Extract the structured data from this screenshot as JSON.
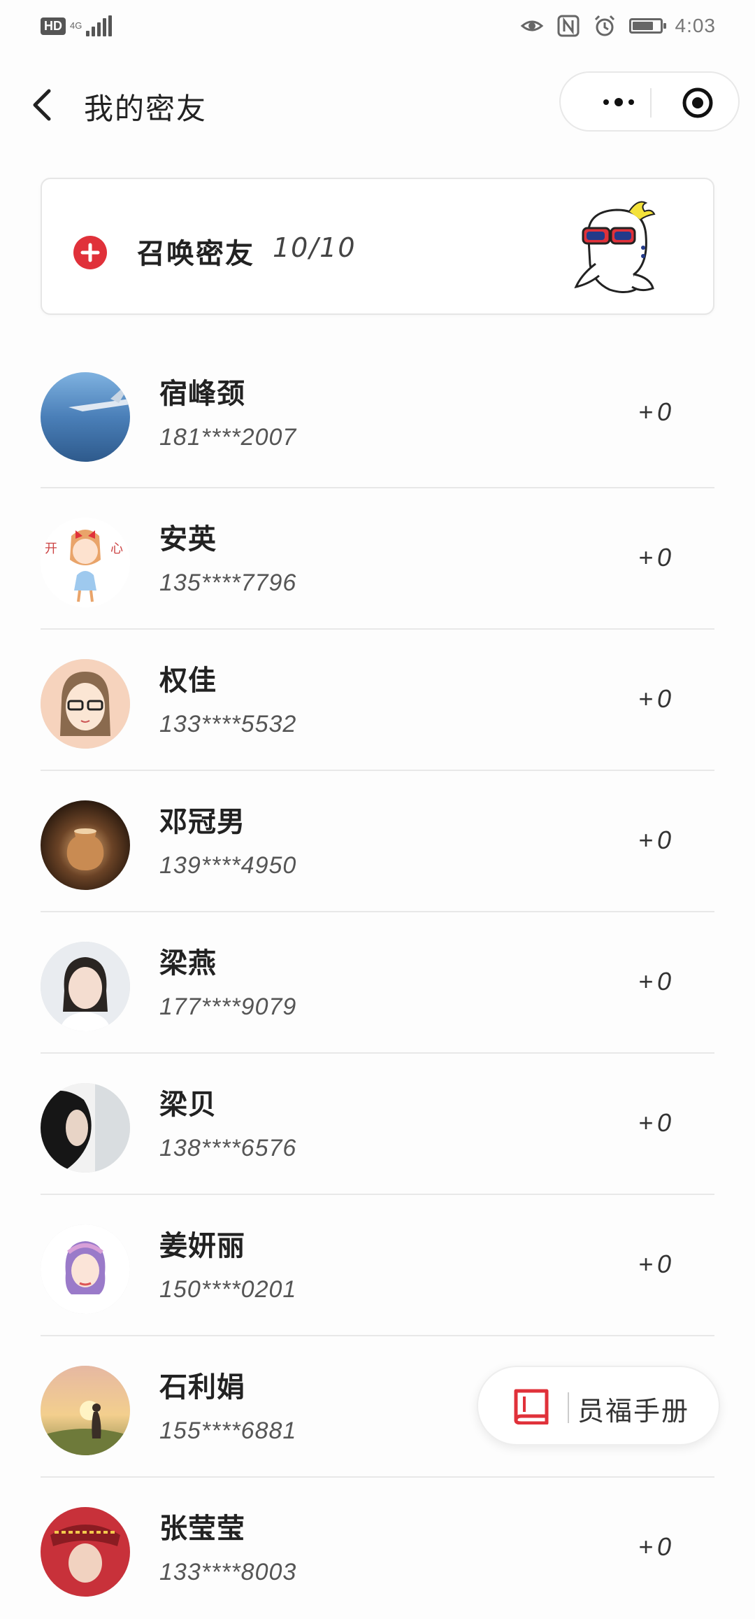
{
  "status_bar": {
    "hd": "HD",
    "network": "4G",
    "time": "4:03"
  },
  "nav": {
    "title": "我的密友"
  },
  "summon": {
    "label": "召唤密友",
    "count": "10/10"
  },
  "friends": [
    {
      "name": "宿峰颈",
      "phone": "181****2007",
      "score": "+0"
    },
    {
      "name": "安英",
      "phone": "135****7796",
      "score": "+0"
    },
    {
      "name": "权佳",
      "phone": "133****5532",
      "score": "+0"
    },
    {
      "name": "邓冠男",
      "phone": "139****4950",
      "score": "+0"
    },
    {
      "name": "梁燕",
      "phone": "177****9079",
      "score": "+0"
    },
    {
      "name": "梁贝",
      "phone": "138****6576",
      "score": "+0"
    },
    {
      "name": "姜妍丽",
      "phone": "150****0201",
      "score": "+0"
    },
    {
      "name": "石利娟",
      "phone": "155****6881",
      "score": ""
    },
    {
      "name": "张莹莹",
      "phone": "133****8003",
      "score": "+0"
    }
  ],
  "handbook": {
    "label": "员福手册"
  },
  "colors": {
    "accent_red": "#e0313a",
    "divider": "#e8e8e8"
  }
}
